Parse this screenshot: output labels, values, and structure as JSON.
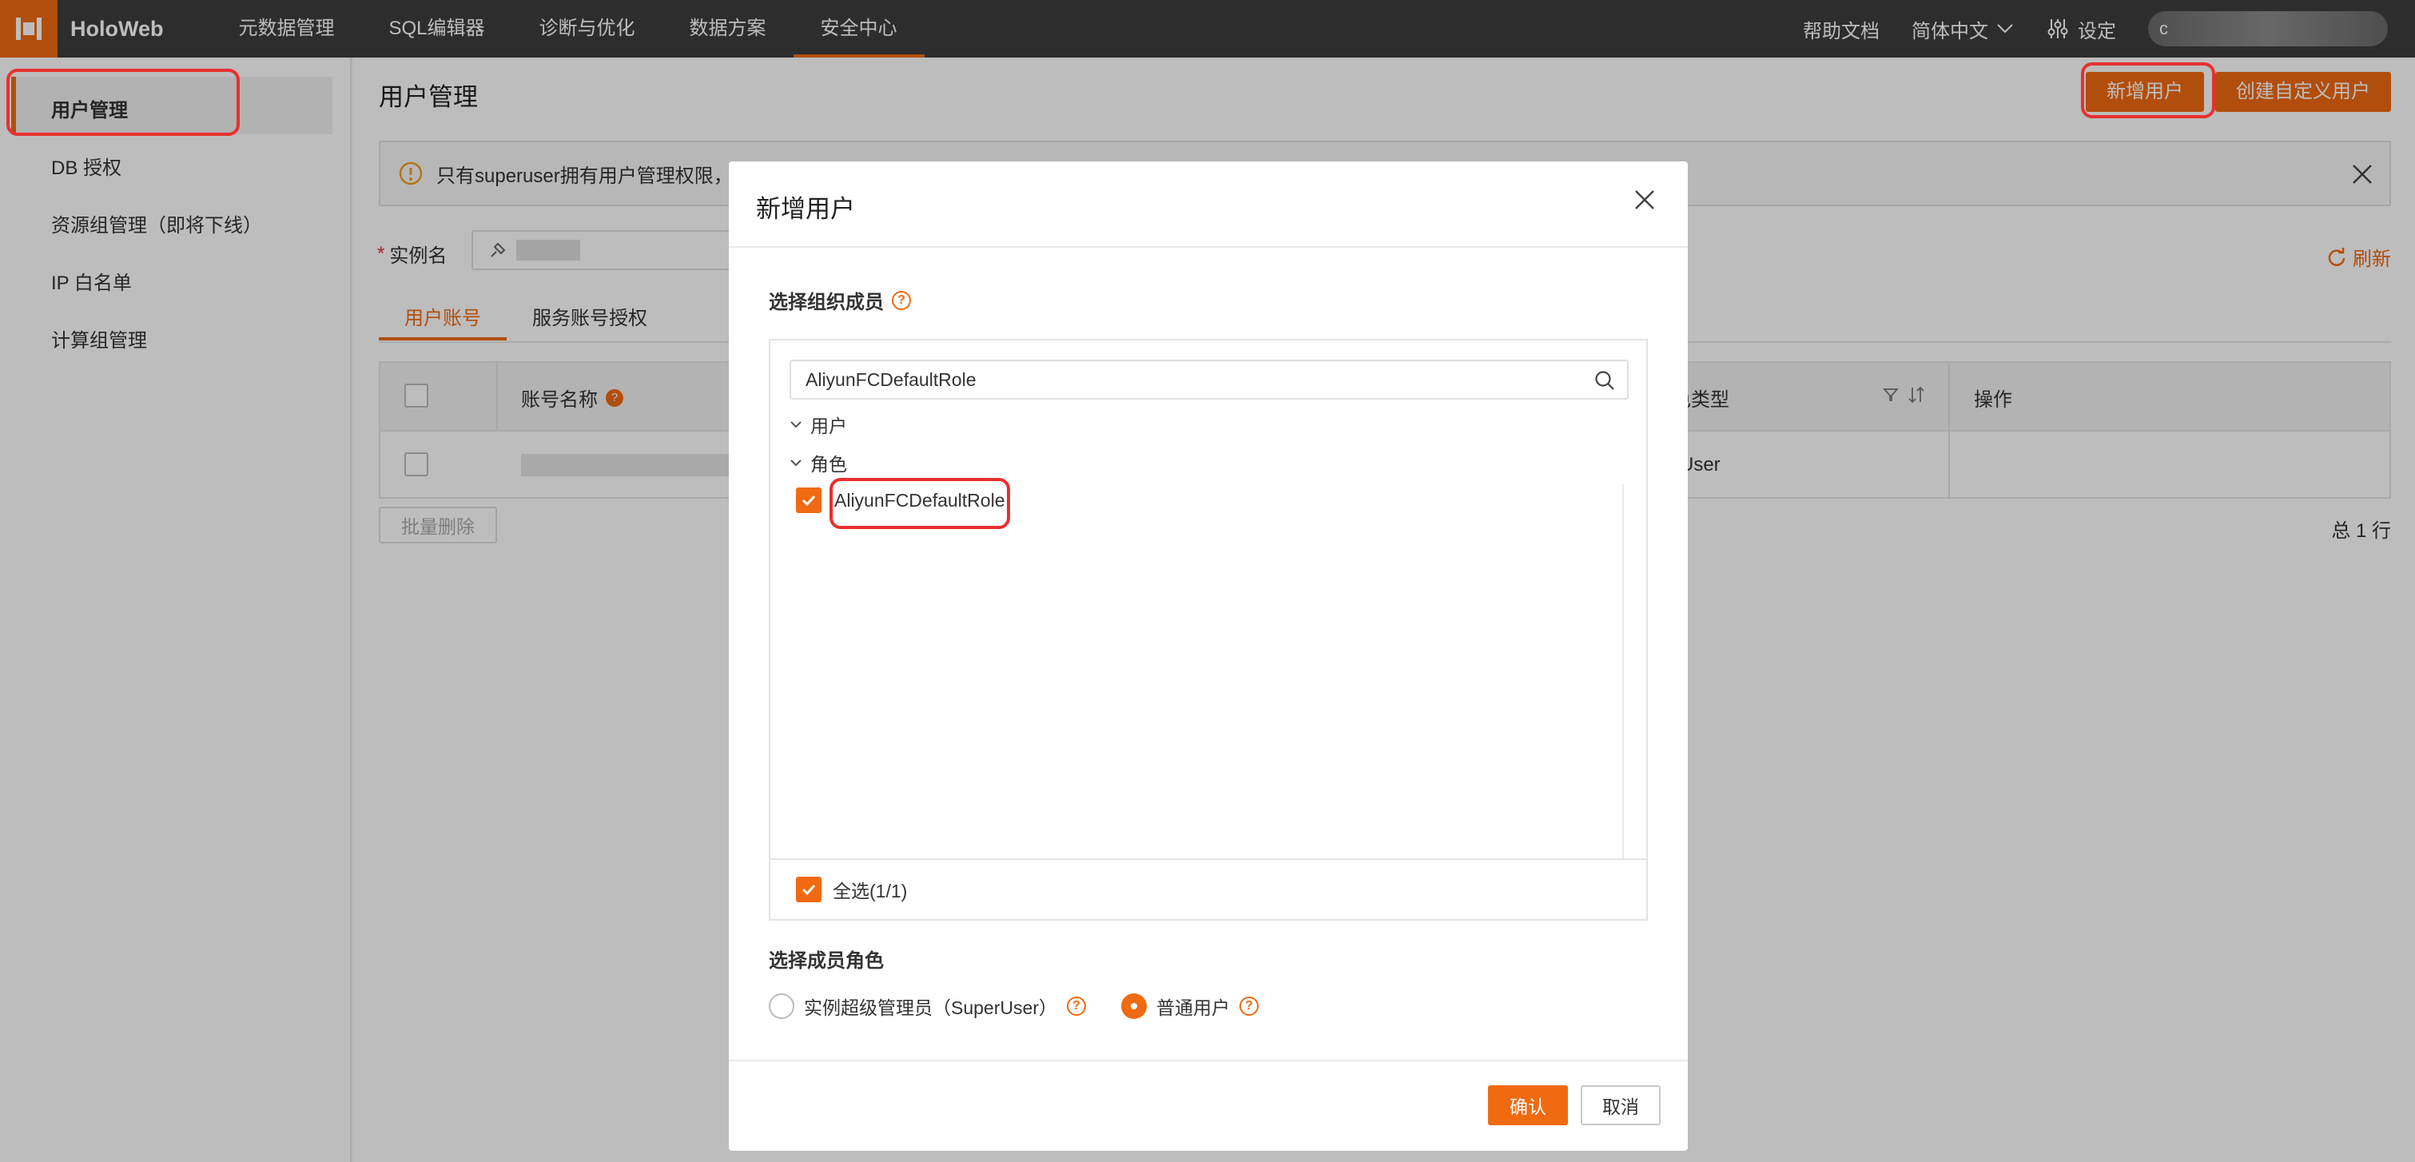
{
  "header": {
    "brand": "HoloWeb",
    "nav": [
      "元数据管理",
      "SQL编辑器",
      "诊断与优化",
      "数据方案",
      "安全中心"
    ],
    "active_nav": "安全中心",
    "right": {
      "help": "帮助文档",
      "language": "简体中文",
      "settings": "设定",
      "account_initial": "c"
    }
  },
  "sidebar": {
    "items": [
      "用户管理",
      "DB 授权",
      "资源组管理（即将下线）",
      "IP 白名单",
      "计算组管理"
    ]
  },
  "main": {
    "title": "用户管理",
    "add_user_button": "新增用户",
    "create_custom_user_button": "创建自定义用户",
    "notice_text": "只有superuser拥有用户管理权限，",
    "instance_label": "实例名",
    "refresh": "刷新",
    "tabs": [
      "用户账号",
      "服务账号授权"
    ],
    "table": {
      "col_account": "账号名称",
      "col_role_type": "色类型",
      "col_ops": "操作",
      "row_role_value": "rUser"
    },
    "batch_delete": "批量删除",
    "total": "总 1 行"
  },
  "modal": {
    "title": "新增用户",
    "select_members_label": "选择组织成员",
    "search_value": "AliyunFCDefaultRole",
    "group_users": "用户",
    "group_roles": "角色",
    "role_item": "AliyunFCDefaultRole",
    "select_all": "全选(1/1)",
    "member_role_label": "选择成员角色",
    "option_superuser": "实例超级管理员（SuperUser）",
    "option_normal": "普通用户",
    "confirm": "确认",
    "cancel": "取消"
  },
  "colors": {
    "accent": "#f06a11",
    "highlight": "#e8302f",
    "topbar": "#3d3d3d"
  }
}
